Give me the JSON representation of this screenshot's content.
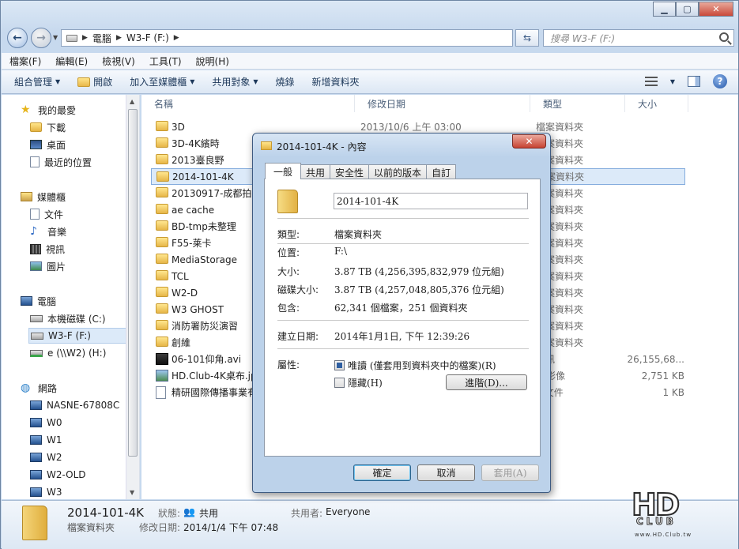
{
  "address": {
    "crumbs": [
      "電腦",
      "W3-F (F:)"
    ],
    "search_placeholder": "搜尋 W3-F (F:)"
  },
  "menubar": [
    "檔案(F)",
    "編輯(E)",
    "檢視(V)",
    "工具(T)",
    "說明(H)"
  ],
  "toolbar": {
    "organize": "組合管理",
    "open": "開啟",
    "include_library": "加入至媒體櫃",
    "share_with": "共用對象",
    "burn": "燒錄",
    "new_folder": "新增資料夾"
  },
  "nav": {
    "favorites": "我的最愛",
    "downloads": "下載",
    "desktop": "桌面",
    "recent": "最近的位置",
    "libraries": "媒體櫃",
    "documents": "文件",
    "music": "音樂",
    "videos": "視訊",
    "pictures": "圖片",
    "computer": "電腦",
    "local_disk": "本機磁碟 (C:)",
    "w3f": "W3-F (F:)",
    "e_drive": "e (\\\\W2) (H:)",
    "network": "網路",
    "hosts": [
      "NASNE-67808C",
      "W0",
      "W1",
      "W2",
      "W2-OLD",
      "W3"
    ]
  },
  "columns": {
    "name": "名稱",
    "date": "修改日期",
    "type": "類型",
    "size": "大小"
  },
  "files": [
    {
      "name": "3D",
      "date": "2013/10/6 上午 03:00",
      "type": "檔案資料夾",
      "size": "",
      "icon": "folder"
    },
    {
      "name": "3D-4K繽時",
      "date": "",
      "type": "檔案資料夾",
      "size": "",
      "icon": "folder"
    },
    {
      "name": "2013臺良野",
      "date": "",
      "type": "檔案資料夾",
      "size": "",
      "icon": "folder"
    },
    {
      "name": "2014-101-4K",
      "date": "",
      "type": "檔案資料夾",
      "size": "",
      "icon": "folder"
    },
    {
      "name": "20130917-成都拍攝",
      "date": "",
      "type": "檔案資料夾",
      "size": "",
      "icon": "folder"
    },
    {
      "name": "ae cache",
      "date": "",
      "type": "檔案資料夾",
      "size": "",
      "icon": "folder"
    },
    {
      "name": "BD-tmp未整理",
      "date": "",
      "type": "檔案資料夾",
      "size": "",
      "icon": "folder"
    },
    {
      "name": "F55-莱卡",
      "date": "",
      "type": "檔案資料夾",
      "size": "",
      "icon": "folder"
    },
    {
      "name": "MediaStorage",
      "date": "",
      "type": "檔案資料夾",
      "size": "",
      "icon": "folder"
    },
    {
      "name": "TCL",
      "date": "",
      "type": "檔案資料夾",
      "size": "",
      "icon": "folder"
    },
    {
      "name": "W2-D",
      "date": "",
      "type": "檔案資料夾",
      "size": "",
      "icon": "folder"
    },
    {
      "name": "W3 GHOST",
      "date": "",
      "type": "檔案資料夾",
      "size": "",
      "icon": "folder"
    },
    {
      "name": "消防署防災演習",
      "date": "",
      "type": "檔案資料夾",
      "size": "",
      "icon": "folder"
    },
    {
      "name": "創維",
      "date": "",
      "type": "檔案資料夾",
      "size": "",
      "icon": "folder"
    },
    {
      "name": "06-101仰角.avi",
      "date": "",
      "type": "視訊",
      "size": "26,155,68...",
      "icon": "video"
    },
    {
      "name": "HD.Club-4K桌布.jp",
      "date": "",
      "type": "G 影像",
      "size": "2,751 KB",
      "icon": "image"
    },
    {
      "name": "精研國際傳播事業有",
      "date": "",
      "type": "F 文件",
      "size": "1 KB",
      "icon": "text"
    }
  ],
  "details": {
    "name": "2014-101-4K",
    "type": "檔案資料夾",
    "state_label": "狀態:",
    "state_value": "共用",
    "shared_with_label": "共用者:",
    "shared_with_value": "Everyone",
    "modified_label": "修改日期:",
    "modified_value": "2014/1/4 下午 07:48"
  },
  "dialog": {
    "title": "2014-101-4K - 內容",
    "tabs": [
      "一般",
      "共用",
      "安全性",
      "以前的版本",
      "自訂"
    ],
    "name_value": "2014-101-4K",
    "type_label": "類型:",
    "type_value": "檔案資料夾",
    "location_label": "位置:",
    "location_value": "F:\\",
    "size_label": "大小:",
    "size_value": "3.87 TB (4,256,395,832,979 位元組)",
    "disk_size_label": "磁碟大小:",
    "disk_size_value": "3.87 TB (4,257,048,805,376 位元組)",
    "contains_label": "包含:",
    "contains_value": "62,341 個檔案，251 個資料夾",
    "created_label": "建立日期:",
    "created_value": "2014年1月1日, 下午 12:39:26",
    "attributes_label": "屬性:",
    "readonly_label": "唯讀 (僅套用到資料夾中的檔案)(R)",
    "hidden_label": "隱藏(H)",
    "advanced_label": "進階(D)...",
    "ok_label": "確定",
    "cancel_label": "取消",
    "apply_label": "套用(A)"
  },
  "watermark": {
    "brand": "HD",
    "sub": "CLUB",
    "url": "www.HD.Club.tw"
  }
}
